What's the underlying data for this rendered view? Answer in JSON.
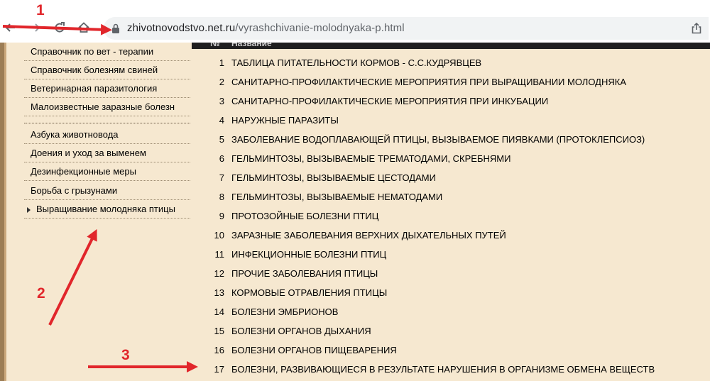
{
  "browser": {
    "url_host": "zhivotnovodstvo.net.ru",
    "url_path": "/vyrashchivanie-molodnyaka-p.html",
    "icons": [
      "back-icon",
      "forward-icon",
      "reload-icon",
      "home-icon",
      "lock-icon",
      "share-icon"
    ]
  },
  "sidebar": {
    "items": [
      {
        "label": "Справочник по вет - терапии"
      },
      {
        "label": "Справочник болезням свиней"
      },
      {
        "label": "Ветеринарная паразитология"
      },
      {
        "label": "Малоизвестные заразные болезн"
      },
      {
        "label": "Азбука животновода"
      },
      {
        "label": "Доения и уход за выменем"
      },
      {
        "label": "Дезинфекционные меры"
      },
      {
        "label": "Борьба с грызунами"
      },
      {
        "label": "Выращивание молодняка птицы",
        "active": true
      }
    ]
  },
  "table": {
    "header_num": "№",
    "header_name": "Название",
    "rows": [
      {
        "num": "1",
        "name": "ТАБЛИЦА ПИТАТЕЛЬНОСТИ КОРМОВ - С.С.КУДРЯВЦЕВ"
      },
      {
        "num": "2",
        "name": "САНИТАРНО-ПРОФИЛАКТИЧЕСКИЕ МЕРОПРИЯТИЯ ПРИ ВЫРАЩИВАНИИ МОЛОДНЯКА"
      },
      {
        "num": "3",
        "name": "САНИТАРНО-ПРОФИЛАКТИЧЕСКИЕ МЕРОПРИЯТИЯ ПРИ ИНКУБАЦИИ"
      },
      {
        "num": "4",
        "name": "НАРУЖНЫЕ ПАРАЗИТЫ"
      },
      {
        "num": "5",
        "name": "ЗАБОЛЕВАНИЕ ВОДОПЛАВАЮЩЕЙ ПТИЦЫ, ВЫЗЫВАЕМОЕ ПИЯВКАМИ (ПРОТОКЛЕПСИОЗ)"
      },
      {
        "num": "6",
        "name": "ГЕЛЬМИНТОЗЫ, ВЫЗЫВАЕМЫЕ ТРЕМАТОДАМИ, СКРЕБНЯМИ"
      },
      {
        "num": "7",
        "name": "ГЕЛЬМИНТОЗЫ, ВЫЗЫВАЕМЫЕ ЦЕСТОДАМИ"
      },
      {
        "num": "8",
        "name": "ГЕЛЬМИНТОЗЫ, ВЫЗЫВАЕМЫЕ НЕМАТОДАМИ"
      },
      {
        "num": "9",
        "name": "ПРОТОЗОЙНЫЕ БОЛЕЗНИ ПТИЦ"
      },
      {
        "num": "10",
        "name": "ЗАРАЗНЫЕ ЗАБОЛЕВАНИЯ ВЕРХНИХ ДЫХАТЕЛЬНЫХ ПУТЕЙ"
      },
      {
        "num": "11",
        "name": "ИНФЕКЦИОННЫЕ БОЛЕЗНИ ПТИЦ"
      },
      {
        "num": "12",
        "name": "ПРОЧИЕ ЗАБОЛЕВАНИЯ ПТИЦЫ"
      },
      {
        "num": "13",
        "name": "КОРМОВЫЕ ОТРАВЛЕНИЯ ПТИЦЫ"
      },
      {
        "num": "14",
        "name": "БОЛЕЗНИ ЭМБРИОНОВ"
      },
      {
        "num": "15",
        "name": "БОЛЕЗНИ ОРГАНОВ ДЫХАНИЯ"
      },
      {
        "num": "16",
        "name": "БОЛЕЗНИ ОРГАНОВ ПИЩЕВАРЕНИЯ"
      },
      {
        "num": "17",
        "name": "БОЛЕЗНИ, РАЗВИВАЮЩИЕСЯ В РЕЗУЛЬТАТЕ НАРУШЕНИЯ В ОРГАНИЗМЕ ОБМЕНА ВЕЩЕСТВ"
      }
    ]
  },
  "annotations": {
    "labels": [
      "1",
      "2",
      "3"
    ],
    "color": "#e1262b"
  },
  "colors": {
    "page_background": "#f6e8d0",
    "header_bar": "#1f1f1f",
    "annotation_red": "#e1262b"
  }
}
